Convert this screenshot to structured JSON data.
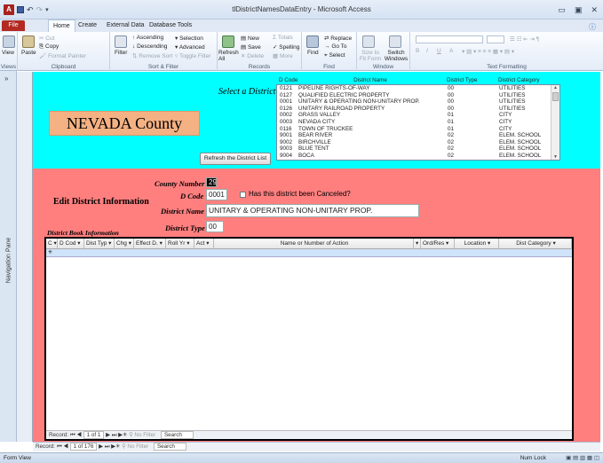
{
  "window": {
    "title": "tlDistrictNamesDataEntry - Microsoft Access",
    "app_icon": "A"
  },
  "quick_access": {
    "icons": [
      "save-icon",
      "undo-icon",
      "redo-icon",
      "customize-icon"
    ]
  },
  "ribbon_tabs": {
    "file": "File",
    "home": "Home",
    "create": "Create",
    "external": "External Data",
    "dbtools": "Database Tools"
  },
  "ribbon": {
    "views": {
      "view": "View",
      "label": "Views"
    },
    "clipboard": {
      "paste": "Paste",
      "cut": "Cut",
      "copy": "Copy",
      "format_painter": "Format Painter",
      "label": "Clipboard"
    },
    "sort_filter": {
      "filter": "Filter",
      "ascending": "Ascending",
      "descending": "Descending",
      "remove_sort": "Remove Sort",
      "selection": "Selection",
      "advanced": "Advanced",
      "toggle_filter": "Toggle Filter",
      "label": "Sort & Filter"
    },
    "records": {
      "refresh": "Refresh All",
      "new": "New",
      "save": "Save",
      "delete": "Delete",
      "totals": "Totals",
      "spelling": "Spelling",
      "more": "More",
      "label": "Records"
    },
    "find": {
      "find": "Find",
      "replace": "Replace",
      "goto": "Go To",
      "select": "Select",
      "label": "Find"
    },
    "window": {
      "size_to_fit": "Size to Fit Form",
      "switch_windows": "Switch Windows",
      "label": "Window"
    },
    "text_formatting": {
      "bold": "B",
      "italic": "I",
      "underline": "U",
      "font_color": "A",
      "label": "Text Formatting"
    }
  },
  "nav_pane": {
    "label": "Navigation Pane"
  },
  "header": {
    "county_title": "NEVADA County",
    "select_label": "Select a District",
    "refresh_button": "Refresh the District List",
    "listbox": {
      "columns": [
        "D Code",
        "District Name",
        "District Type",
        "District Category"
      ],
      "rows": [
        [
          "0121",
          "PIPELINE RIGHTS-OF-WAY",
          "00",
          "UTILITIES"
        ],
        [
          "0127",
          "QUALIFIED ELECTRIC PROPERTY",
          "00",
          "UTILITIES"
        ],
        [
          "0001",
          "UNITARY & OPERATING NON-UNITARY PROP.",
          "00",
          "UTILITIES"
        ],
        [
          "0126",
          "UNITARY RAILROAD PROPERTY",
          "00",
          "UTILITIES"
        ],
        [
          "0002",
          "GRASS VALLEY",
          "01",
          "CITY"
        ],
        [
          "0003",
          "NEVADA CITY",
          "01",
          "CITY"
        ],
        [
          "0116",
          "TOWN OF TRUCKEE",
          "01",
          "CITY"
        ],
        [
          "9001",
          "BEAR RIVER",
          "02",
          "ELEM. SCHOOL"
        ],
        [
          "9002",
          "BIRCHVILLE",
          "02",
          "ELEM. SCHOOL"
        ],
        [
          "9003",
          "BLUE TENT",
          "02",
          "ELEM. SCHOOL"
        ],
        [
          "9004",
          "BOCA",
          "02",
          "ELEM. SCHOOL"
        ]
      ]
    }
  },
  "detail": {
    "county_number_label": "County Number",
    "county_number_value": "29",
    "dcode_label": "D Code",
    "dcode_value": "0001",
    "canceled_label": "Has this district been Canceled?",
    "district_name_label": "District Name",
    "district_name_value": "UNITARY & OPERATING NON-UNITARY PROP.",
    "district_type_label": "District Type",
    "district_type_value": "00",
    "edit_title": "Edit District Information",
    "book_label": "District Book Information"
  },
  "subform": {
    "columns": [
      "C ▾",
      "D Cod ▾",
      "Dist Typ ▾",
      "Chg ▾",
      "Effect D. ▾",
      "Roll Yr ▾",
      "Act ▾",
      "Name or Number of Action",
      "▾",
      "Ord/Res ▾",
      "Location ▾",
      "Dist Category ▾"
    ],
    "new_row_marker": "✳",
    "nav": {
      "record": "Record:",
      "position": "1 of 1",
      "filter": "No Filter",
      "search": "Search"
    }
  },
  "main_nav": {
    "record": "Record:",
    "position": "1 of 176",
    "filter": "No Filter",
    "search": "Search"
  },
  "status": {
    "left": "Form View",
    "numlock": "Num Lock"
  }
}
